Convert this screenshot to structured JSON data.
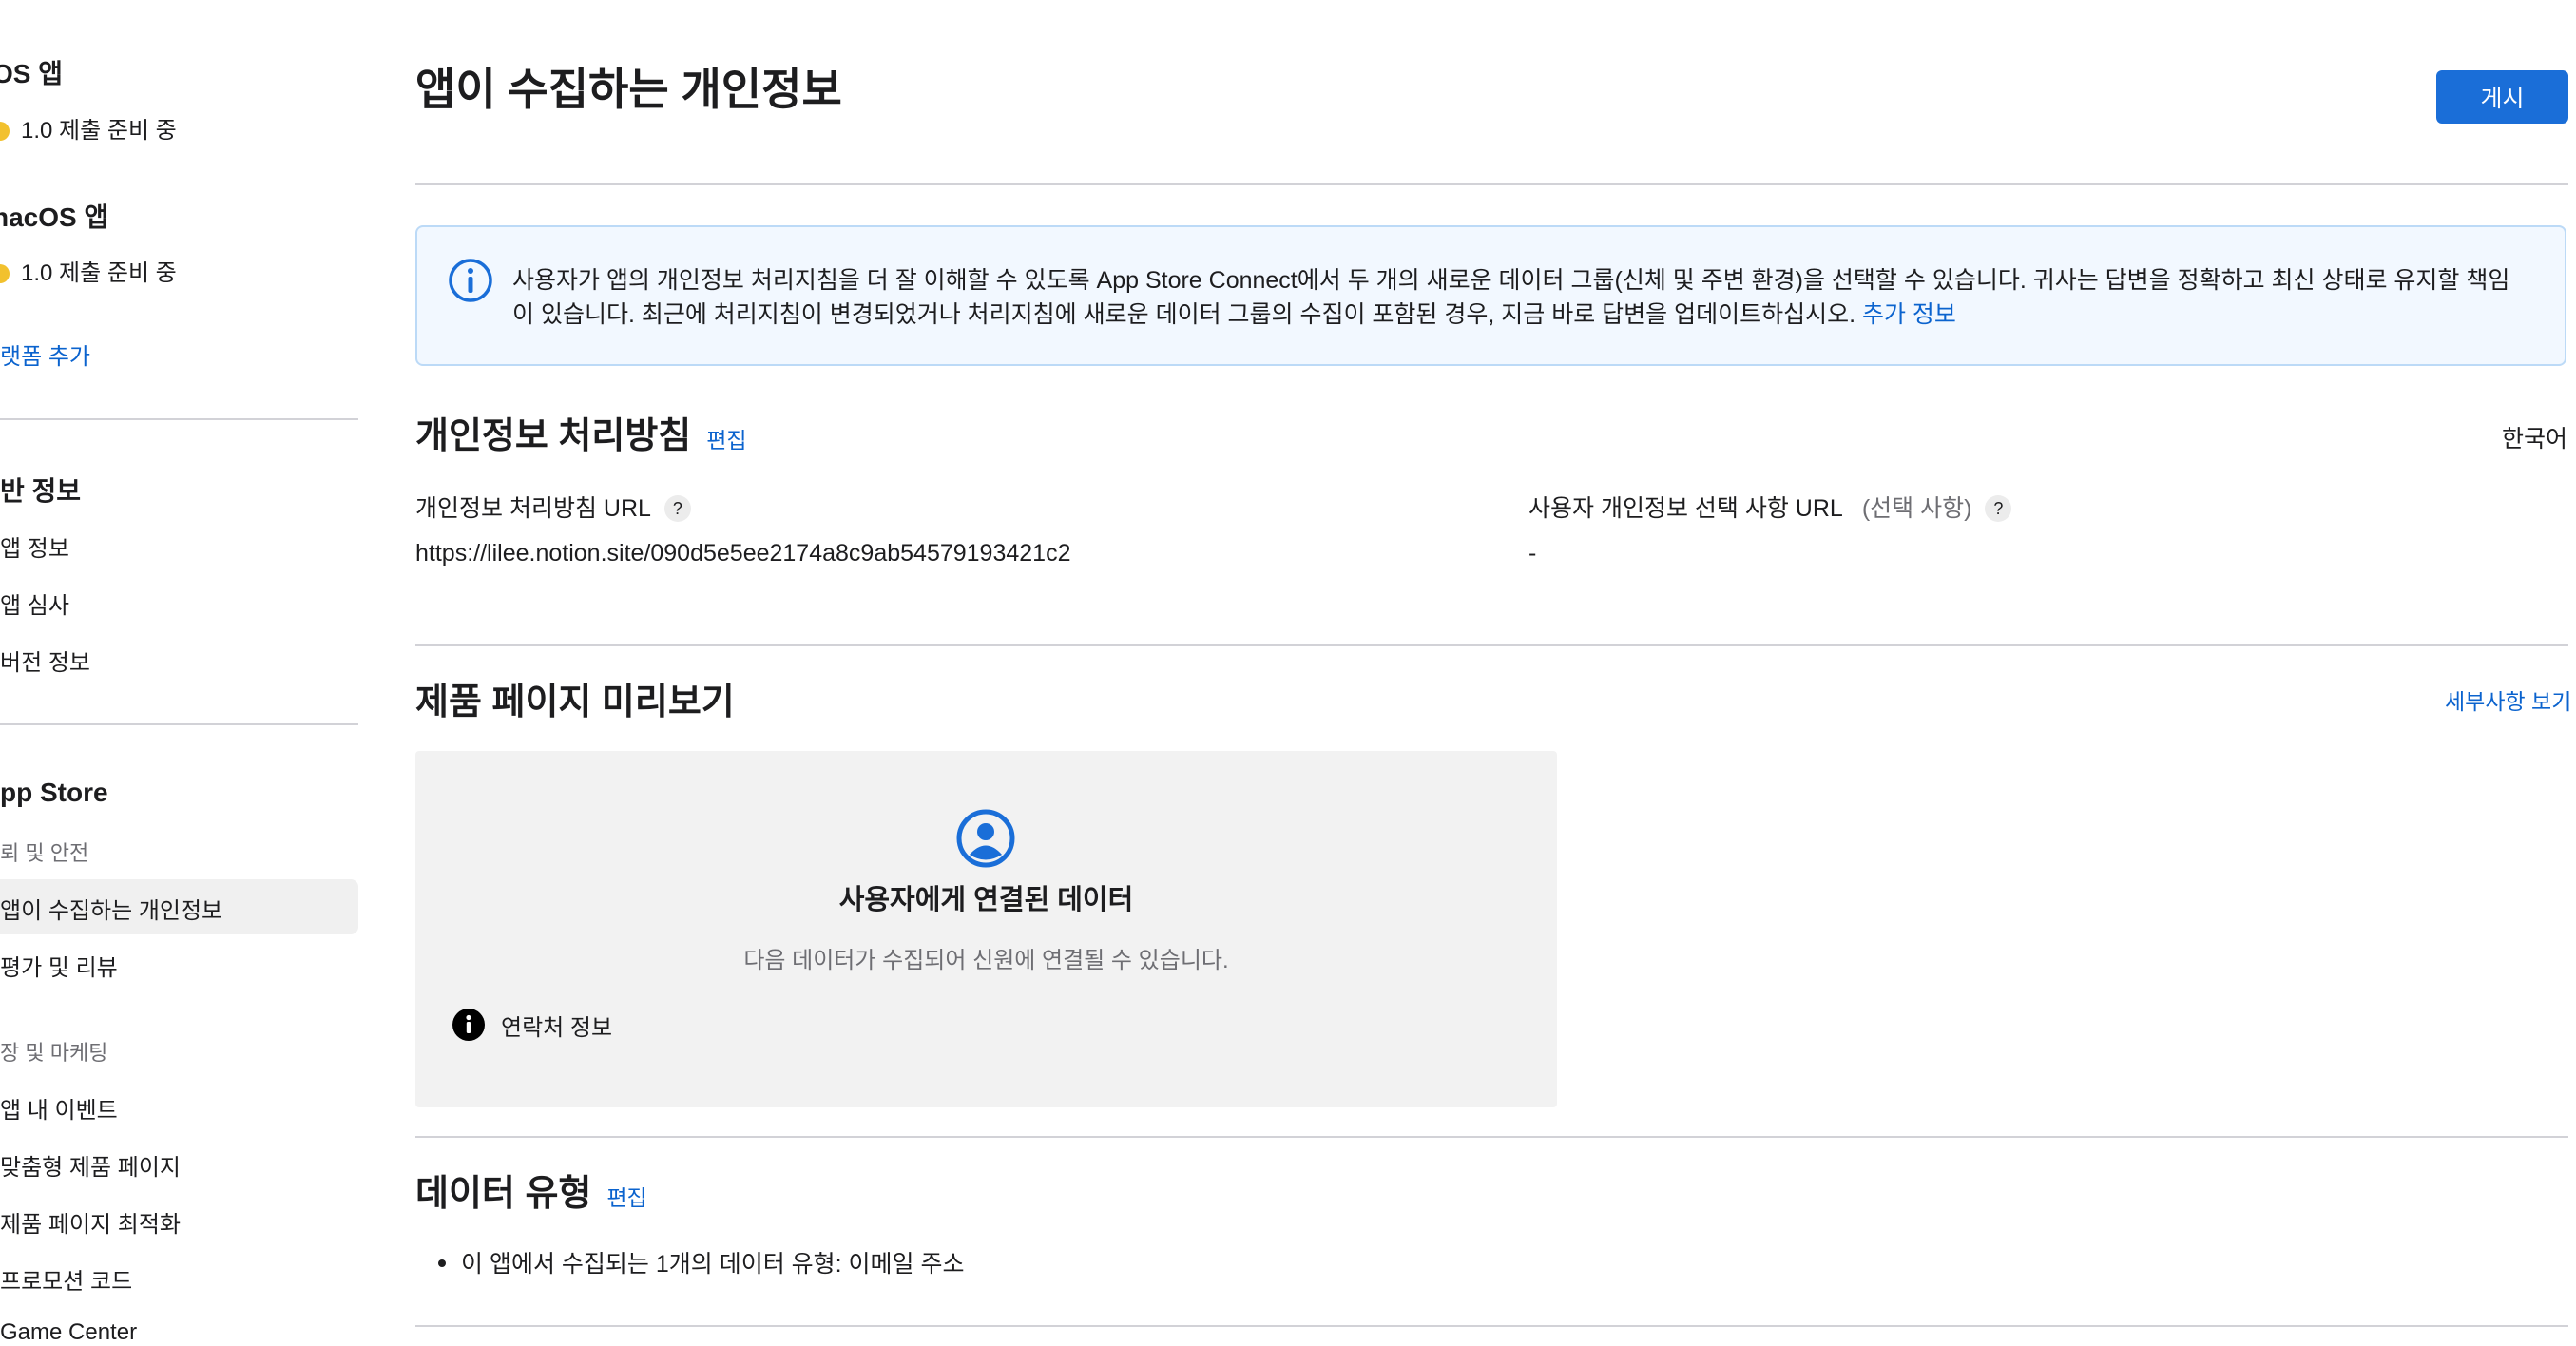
{
  "sidebar": {
    "ios_heading": "OS 앱",
    "ios_status": "1.0 제출 준비 중",
    "macos_heading": "nacOS 앱",
    "macos_status": "1.0 제출 준비 중",
    "add_platform": "랫폼 추가",
    "general_heading": "반 정보",
    "general_items": [
      "앱 정보",
      "앱 심사",
      "버전 정보"
    ],
    "appstore_heading": "pp Store",
    "trust_safety": "뢰 및 안전",
    "trust_items": [
      "앱이 수집하는 개인정보",
      "평가 및 리뷰"
    ],
    "marketing": "장 및 마케팅",
    "marketing_items": [
      "앱 내 이벤트",
      "맞춤형 제품 페이지",
      "제품 페이지 최적화",
      "프로모션 코드"
    ],
    "game_center": "Game Center"
  },
  "page": {
    "title": "앱이 수집하는 개인정보",
    "publish_button": "게시"
  },
  "notice": {
    "text": "사용자가 앱의 개인정보 처리지침을 더 잘 이해할 수 있도록 App Store Connect에서 두 개의 새로운 데이터 그룹(신체 및 주변 환경)을 선택할 수 있습니다. 귀사는 답변을 정확하고 최신 상태로 유지할 책임이 있습니다. 최근에 처리지침이 변경되었거나 처리지침에 새로운 데이터 그룹의 수집이 포함된 경우, 지금 바로 답변을 업데이트하십시오.",
    "link": "추가 정보"
  },
  "privacy_policy": {
    "heading": "개인정보 처리방침",
    "edit": "편집",
    "language": "한국어",
    "url_label": "개인정보 처리방침 URL",
    "url_value": "https://lilee.notion.site/090d5e5ee2174a8c9ab54579193421c2",
    "choices_label": "사용자 개인정보 선택 사항 URL",
    "choices_optional": "(선택 사항)",
    "choices_value": "-",
    "help": "?"
  },
  "preview": {
    "heading": "제품 페이지 미리보기",
    "details_link": "세부사항 보기",
    "card_title": "사용자에게 연결된 데이터",
    "card_subtitle": "다음 데이터가 수집되어 신원에 연결될 수 있습니다.",
    "item": "연락처 정보"
  },
  "data_types": {
    "heading": "데이터 유형",
    "edit": "편집",
    "summary": "이 앱에서 수집되는 1개의 데이터 유형: 이메일 주소"
  },
  "colors": {
    "accent": "#0b63ce",
    "button": "#1a6ed8",
    "status_dot": "#f2c12e",
    "notice_bg": "#f2f8ff",
    "notice_border": "#bcdaf7"
  }
}
